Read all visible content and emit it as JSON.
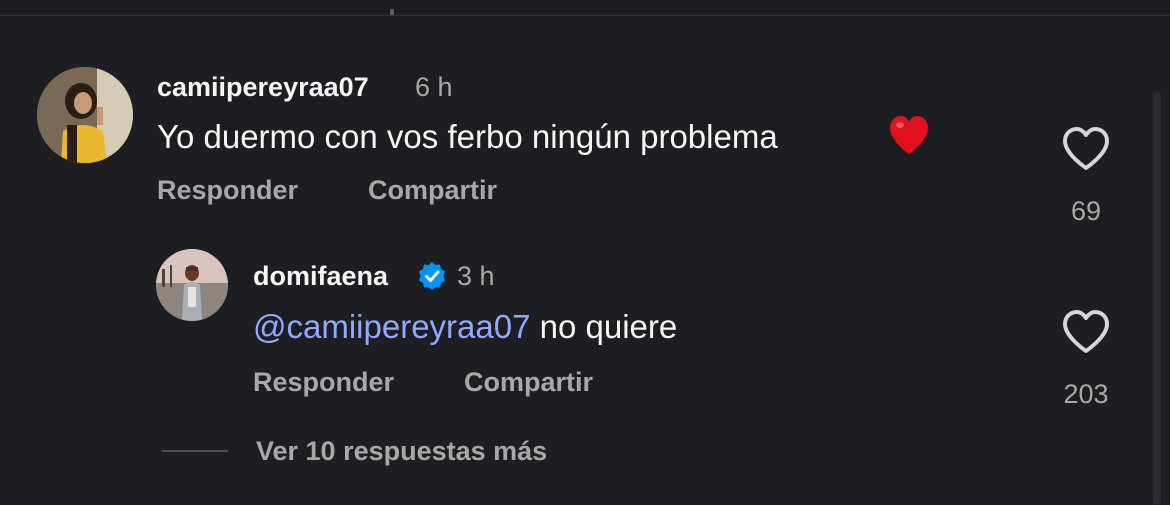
{
  "comments": [
    {
      "username": "camiipereyraa07",
      "time": "6 h",
      "text": "Yo duermo con vos ferbo ningún problema",
      "emoji": "red-heart",
      "reply_label": "Responder",
      "share_label": "Compartir",
      "likes": "69"
    },
    {
      "username": "domifaena",
      "verified": true,
      "time": "3 h",
      "mention": "@camiipereyraa07",
      "text": "no quiere",
      "reply_label": "Responder",
      "share_label": "Compartir",
      "likes": "203"
    }
  ],
  "view_more_replies": "Ver 10 respuestas más",
  "colors": {
    "background": "#1c1e21",
    "primary_text": "#f5f5f5",
    "secondary_text": "#a8a8a8",
    "mention": "#8fa9ff",
    "verified_badge": "#0095f6",
    "heart_emoji": "#e0111f"
  }
}
